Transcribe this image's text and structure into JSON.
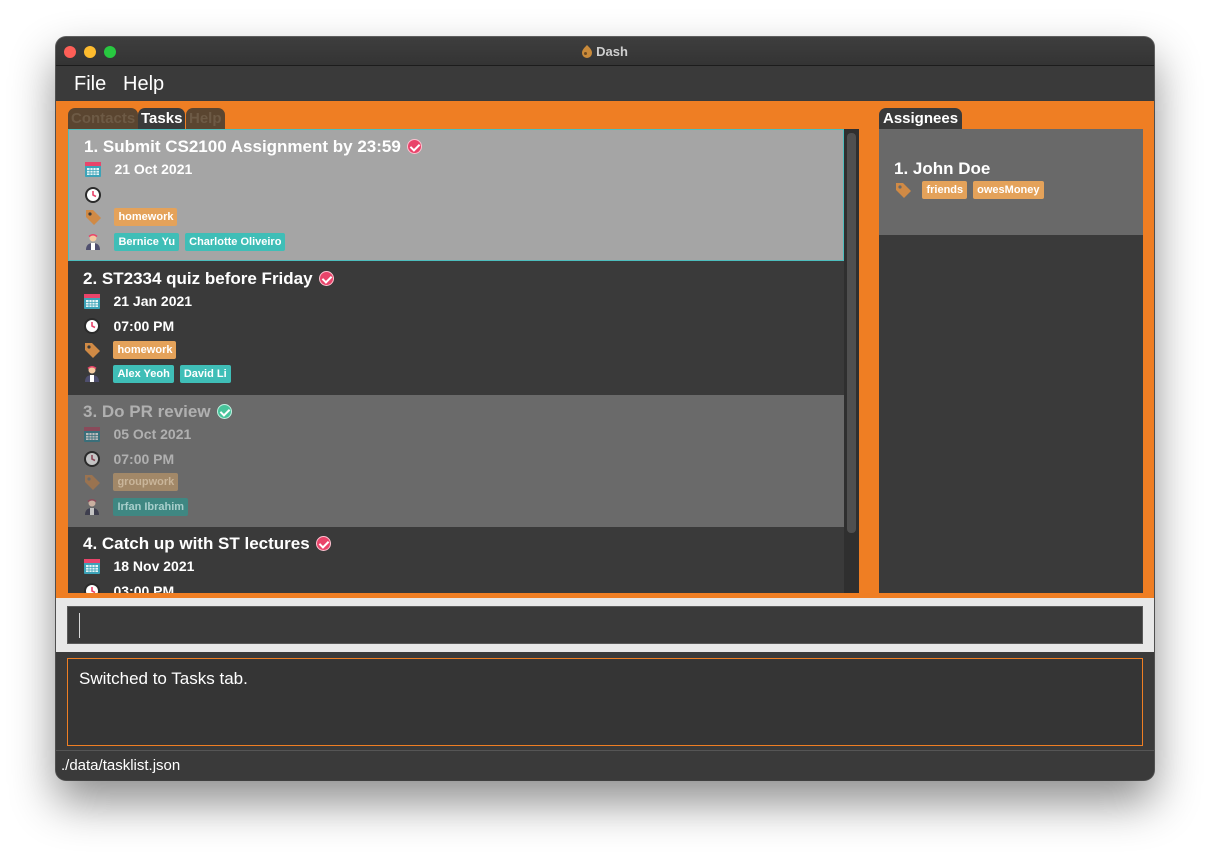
{
  "window": {
    "title": "Dash"
  },
  "menu": {
    "file": "File",
    "help": "Help"
  },
  "tabs": [
    {
      "label": "Contacts",
      "active": false
    },
    {
      "label": "Tasks",
      "active": true
    },
    {
      "label": "Help",
      "active": false
    }
  ],
  "tasks": [
    {
      "title": "1.  Submit CS2100 Assignment by 23:59",
      "date": "21 Oct 2021",
      "time": "",
      "tags": [
        "homework"
      ],
      "people": [
        "Bernice Yu",
        "Charlotte Oliveiro"
      ],
      "status": "incomplete"
    },
    {
      "title": "2.  ST2334 quiz before Friday",
      "date": "21 Jan 2021",
      "time": "07:00 PM",
      "tags": [
        "homework"
      ],
      "people": [
        "Alex Yeoh",
        "David Li"
      ],
      "status": "incomplete"
    },
    {
      "title": "3.  Do PR review",
      "date": "05 Oct 2021",
      "time": "07:00 PM",
      "tags": [
        "groupwork"
      ],
      "people": [
        "Irfan Ibrahim"
      ],
      "status": "complete"
    },
    {
      "title": "4.  Catch up with ST lectures",
      "date": "18 Nov 2021",
      "time": "03:00 PM",
      "tags": [],
      "people": [],
      "status": "incomplete"
    }
  ],
  "assignees": {
    "tab_label": "Assignees",
    "items": [
      {
        "name": "1.  John Doe",
        "tags": [
          "friends",
          "owesMoney"
        ]
      }
    ]
  },
  "command": {
    "value": ""
  },
  "result": {
    "text": "Switched to Tasks tab."
  },
  "status": {
    "path": "./data/tasklist.json"
  },
  "colors": {
    "accent": "#ef7e23",
    "tag": "#e4a25a",
    "person": "#3fbeb7",
    "incomplete_check": "#e9446a",
    "complete_check": "#48c49b"
  }
}
